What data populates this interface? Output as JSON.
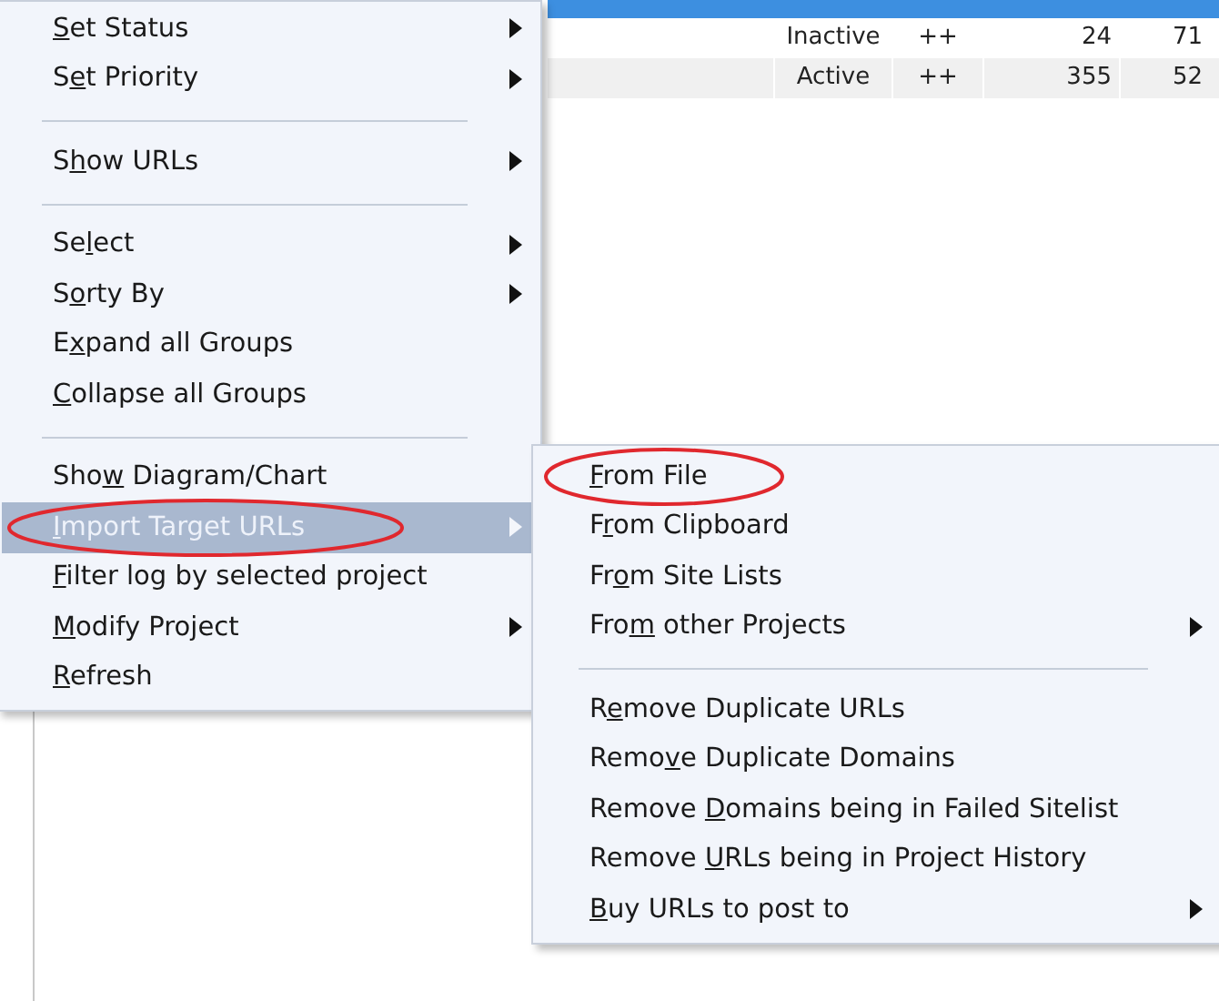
{
  "table": {
    "rows": [
      {
        "selected": true
      },
      {
        "selected": false,
        "cells": [
          "Inactive",
          "++",
          "24",
          "71"
        ]
      },
      {
        "selected": false,
        "cells": [
          "Active",
          "++",
          "355",
          "52"
        ]
      }
    ]
  },
  "context_menu": {
    "items": [
      {
        "kind": "item",
        "label": {
          "key": "S",
          "post": "et Status"
        },
        "submenu": true,
        "highlighted": false,
        "circled": false
      },
      {
        "kind": "item",
        "label": {
          "pre": "S",
          "key": "e",
          "post": "t Priority"
        },
        "submenu": true,
        "highlighted": false,
        "circled": false
      },
      {
        "kind": "separator"
      },
      {
        "kind": "item",
        "label": {
          "pre": "S",
          "key": "h",
          "post": "ow URLs"
        },
        "submenu": true,
        "highlighted": false,
        "circled": false
      },
      {
        "kind": "separator"
      },
      {
        "kind": "item",
        "label": {
          "pre": "Se",
          "key": "l",
          "post": "ect"
        },
        "submenu": true,
        "highlighted": false,
        "circled": false
      },
      {
        "kind": "item",
        "label": {
          "pre": "S",
          "key": "o",
          "post": "rty By"
        },
        "submenu": true,
        "highlighted": false,
        "circled": false
      },
      {
        "kind": "item",
        "label": {
          "pre": "E",
          "key": "x",
          "post": "pand all Groups"
        },
        "submenu": false,
        "highlighted": false,
        "circled": false
      },
      {
        "kind": "item",
        "label": {
          "key": "C",
          "post": "ollapse all Groups"
        },
        "submenu": false,
        "highlighted": false,
        "circled": false
      },
      {
        "kind": "separator"
      },
      {
        "kind": "item",
        "label": {
          "pre": "Sho",
          "key": "w",
          "post": " Diagram/Chart"
        },
        "submenu": false,
        "highlighted": false,
        "circled": false
      },
      {
        "kind": "item",
        "label": {
          "key": "I",
          "post": "mport Target URLs"
        },
        "submenu": true,
        "highlighted": true,
        "circled": true
      },
      {
        "kind": "item",
        "label": {
          "key": "F",
          "post": "ilter log by selected project"
        },
        "submenu": false,
        "highlighted": false,
        "circled": false
      },
      {
        "kind": "item",
        "label": {
          "key": "M",
          "post": "odify Project"
        },
        "submenu": true,
        "highlighted": false,
        "circled": false
      },
      {
        "kind": "item",
        "label": {
          "key": "R",
          "post": "efresh"
        },
        "submenu": false,
        "highlighted": false,
        "circled": false
      }
    ]
  },
  "submenu": {
    "items": [
      {
        "kind": "item",
        "label": {
          "key": "F",
          "post": "rom File"
        },
        "submenu": false,
        "highlighted": false,
        "circled": true
      },
      {
        "kind": "item",
        "label": {
          "pre": "F",
          "key": "r",
          "post": "om Clipboard"
        },
        "submenu": false,
        "highlighted": false,
        "circled": false
      },
      {
        "kind": "item",
        "label": {
          "pre": "Fr",
          "key": "o",
          "post": "m Site Lists"
        },
        "submenu": false,
        "highlighted": false,
        "circled": false
      },
      {
        "kind": "item",
        "label": {
          "pre": "Fro",
          "key": "m",
          "post": " other Projects"
        },
        "submenu": true,
        "highlighted": false,
        "circled": false
      },
      {
        "kind": "separator"
      },
      {
        "kind": "item",
        "label": {
          "pre": "R",
          "key": "e",
          "post": "move Duplicate URLs"
        },
        "submenu": false,
        "highlighted": false,
        "circled": false
      },
      {
        "kind": "item",
        "label": {
          "pre": "Remo",
          "key": "v",
          "post": "e Duplicate Domains"
        },
        "submenu": false,
        "highlighted": false,
        "circled": false
      },
      {
        "kind": "item",
        "label": {
          "pre": "Remove ",
          "key": "D",
          "post": "omains being in Failed Sitelist"
        },
        "submenu": false,
        "highlighted": false,
        "circled": false
      },
      {
        "kind": "item",
        "label": {
          "pre": "Remove ",
          "key": "U",
          "post": "RLs being in Project History"
        },
        "submenu": false,
        "highlighted": false,
        "circled": false
      },
      {
        "kind": "item",
        "label": {
          "key": "B",
          "post": "uy URLs to post to"
        },
        "submenu": true,
        "highlighted": false,
        "circled": false
      }
    ]
  }
}
